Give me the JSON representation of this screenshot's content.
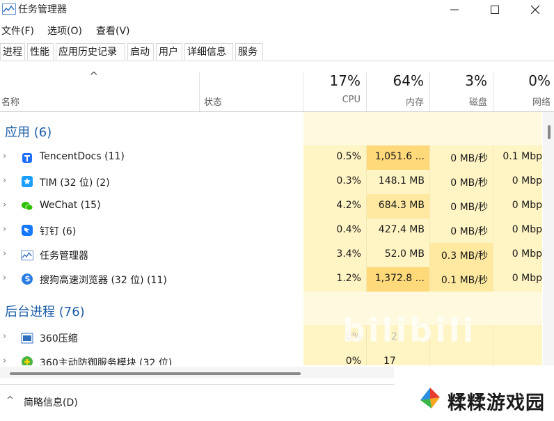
{
  "window": {
    "title": "任务管理器",
    "controls": {
      "minimize": "—",
      "maximize": "☐",
      "close": "✕"
    }
  },
  "menu": [
    "文件(F)",
    "选项(O)",
    "查看(V)"
  ],
  "tabs": [
    "进程",
    "性能",
    "应用历史记录",
    "启动",
    "用户",
    "详细信息",
    "服务"
  ],
  "header": {
    "sort_indicator": "^",
    "name": "名称",
    "status": "状态",
    "cpu": {
      "pct": "17%",
      "label": "CPU"
    },
    "memory": {
      "pct": "64%",
      "label": "内存"
    },
    "disk": {
      "pct": "3%",
      "label": "磁盘"
    },
    "network": {
      "pct": "0%",
      "label": "网络"
    }
  },
  "groups": {
    "apps": "应用 (6)",
    "background": "后台进程 (76)"
  },
  "apps": [
    {
      "name": "TencentDocs (11)",
      "cpu": "0.5%",
      "mem": "1,051.6 ...",
      "disk": "0 MB/秒",
      "net": "0.1 Mbp",
      "icon": "tencentdocs-icon"
    },
    {
      "name": "TIM (32 位) (2)",
      "cpu": "0.3%",
      "mem": "148.1 MB",
      "disk": "0 MB/秒",
      "net": "0 Mbp",
      "icon": "tim-icon"
    },
    {
      "name": "WeChat (15)",
      "cpu": "4.2%",
      "mem": "684.3 MB",
      "disk": "0 MB/秒",
      "net": "0 Mbp",
      "icon": "wechat-icon"
    },
    {
      "name": "钉钉 (6)",
      "cpu": "0.4%",
      "mem": "427.4 MB",
      "disk": "0 MB/秒",
      "net": "0 Mbp",
      "icon": "dingtalk-icon"
    },
    {
      "name": "任务管理器",
      "cpu": "3.4%",
      "mem": "52.0 MB",
      "disk": "0.3 MB/秒",
      "net": "0 Mbp",
      "icon": "taskmanager-icon"
    },
    {
      "name": "搜狗高速浏览器 (32 位) (11)",
      "cpu": "1.2%",
      "mem": "1,372.8 ...",
      "disk": "0.1 MB/秒",
      "net": "0 Mbp",
      "icon": "sogou-browser-icon"
    }
  ],
  "background": [
    {
      "name": "360压缩",
      "cpu": "0%",
      "mem": "2",
      "icon": "360zip-icon"
    },
    {
      "name": "360主动防御服务模块 (32 位)",
      "cpu": "0%",
      "mem": "17",
      "icon": "360-defense-icon"
    }
  ],
  "footer": {
    "label": "简略信息(D)",
    "chevron": "^"
  },
  "watermark": {
    "text": "糅糅游戏园",
    "bili": "bilibili"
  },
  "colors": {
    "accent": "#1c5da8",
    "heat_light": "#fff4c4",
    "heat_mid": "#ffe9a0",
    "heat_high": "#ffd97a"
  }
}
